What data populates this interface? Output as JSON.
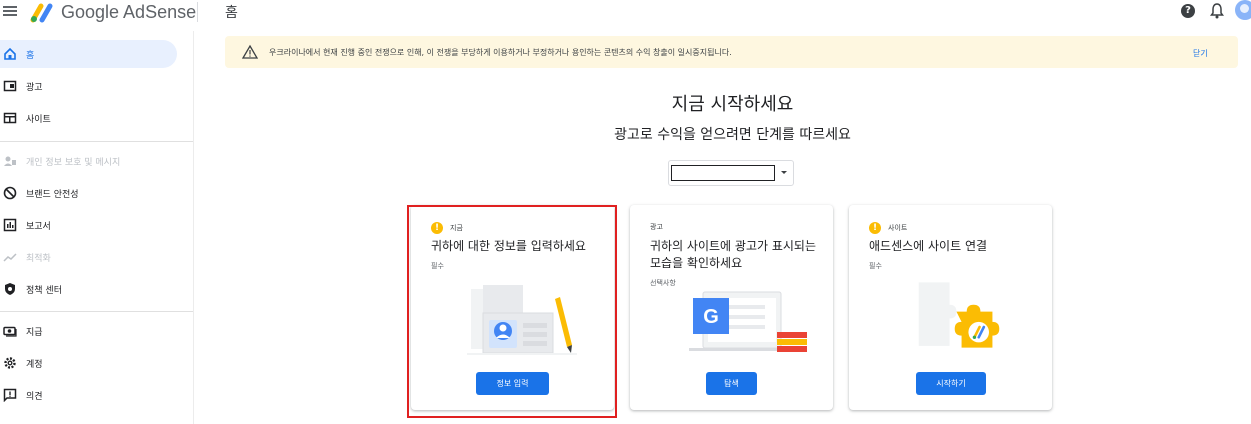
{
  "header": {
    "brand": "Google AdSense",
    "page_title": "홈",
    "help_glyph": "?"
  },
  "sidebar": {
    "items": [
      {
        "label": "홈",
        "icon": "home-icon",
        "state": "active"
      },
      {
        "label": "광고",
        "icon": "ads-icon",
        "state": "normal"
      },
      {
        "label": "사이트",
        "icon": "sites-icon",
        "state": "normal"
      },
      {
        "label": "개인 정보 보호 및 메시지",
        "icon": "privacy-messaging-icon",
        "state": "disabled"
      },
      {
        "label": "브랜드 안전성",
        "icon": "block-icon",
        "state": "normal"
      },
      {
        "label": "보고서",
        "icon": "reports-icon",
        "state": "normal"
      },
      {
        "label": "최적화",
        "icon": "optimization-icon",
        "state": "disabled"
      },
      {
        "label": "정책 센터",
        "icon": "policy-shield-icon",
        "state": "normal"
      },
      {
        "label": "지급",
        "icon": "payments-icon",
        "state": "normal"
      },
      {
        "label": "계정",
        "icon": "settings-gear-icon",
        "state": "normal"
      },
      {
        "label": "의견",
        "icon": "feedback-icon",
        "state": "normal"
      }
    ]
  },
  "banner": {
    "text": "우크라이나에서 현재 진행 중인 전쟁으로 인해, 이 전쟁을 부당하게 이용하거나 부정하거나 용인하는 콘텐츠의 수익 창출이 일시중지됩니다.",
    "close_label": "닫기"
  },
  "main": {
    "heading": "지금 시작하세요",
    "subheading": "광고로 수익을 얻으려면 단계를 따르세요",
    "select_value": ""
  },
  "cards": [
    {
      "status": "지금",
      "has_status_icon": true,
      "title": "귀하에 대한 정보를 입력하세요",
      "requirement": "필수",
      "button": "정보 입력",
      "highlighted": true
    },
    {
      "status": "광고",
      "has_status_icon": false,
      "title": "귀하의 사이트에 광고가 표시되는 모습을 확인하세요",
      "requirement": "선택사항",
      "button": "탐색",
      "highlighted": false
    },
    {
      "status": "사이트",
      "has_status_icon": true,
      "title": "애드센스에 사이트 연결",
      "requirement": "필수",
      "button": "시작하기",
      "highlighted": false
    }
  ],
  "colors": {
    "accent": "#1a73e8",
    "banner_bg": "#fef7e0",
    "status_warning": "#fbbc04",
    "highlight_border": "#e02020"
  }
}
